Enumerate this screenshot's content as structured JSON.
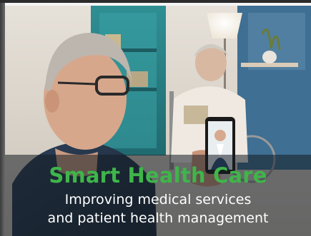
{
  "hero": {
    "headline": "Smart Health Care",
    "subtitle_line1": "Improving medical services",
    "subtitle_line2": "and patient health management"
  },
  "colors": {
    "headline": "#3fb54a",
    "subtitle": "#ffffff",
    "overlay": "#141c22"
  }
}
